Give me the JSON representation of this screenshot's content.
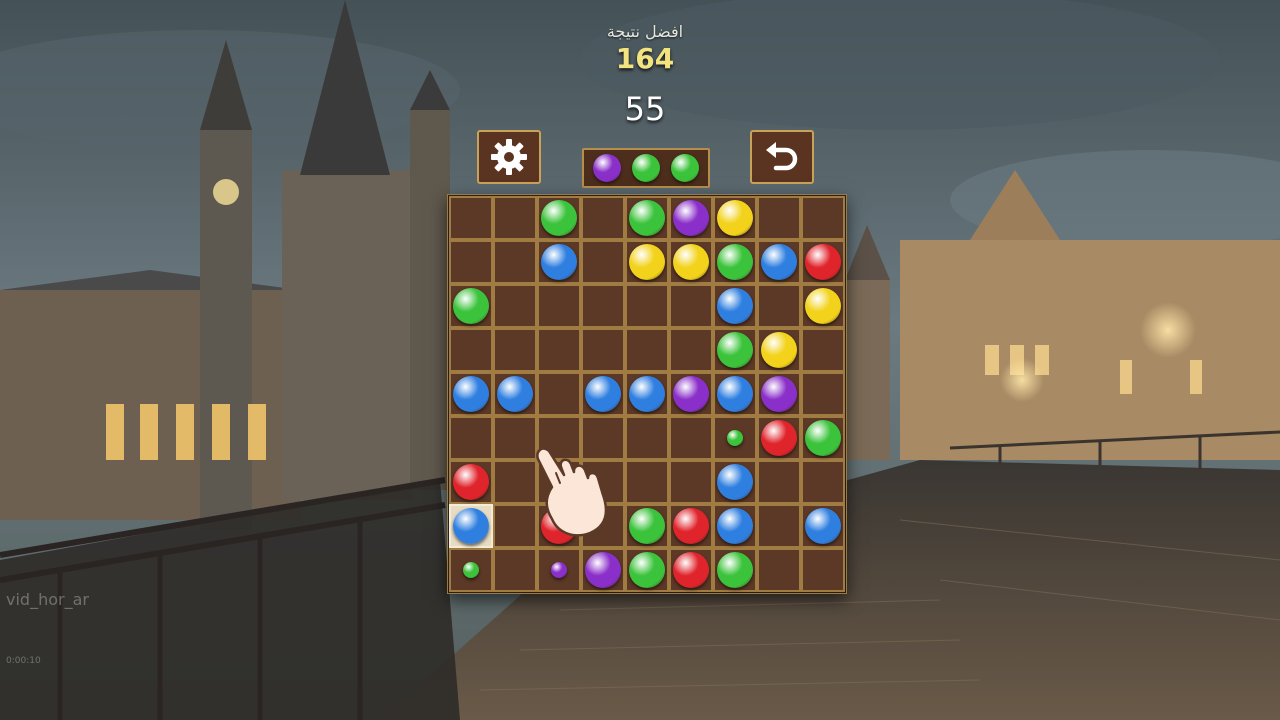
{
  "score": {
    "best_label": "افضل نتيجة",
    "best_value": "164",
    "current_value": "55"
  },
  "toolbar": {
    "settings_icon": "gear-icon",
    "undo_icon": "undo-arrow-icon"
  },
  "next_balls": [
    "purple",
    "green",
    "green"
  ],
  "colors": {
    "green": "#3cc33c",
    "purple": "#8a2fc9",
    "yellow": "#f2d21a",
    "blue": "#2f7fe0",
    "red": "#e0242c",
    "cell": "#5c3826",
    "cell_border": "#a07b42",
    "panel": "#5a3420",
    "score_gold": "#f3e37e"
  },
  "board": {
    "rows": [
      [
        "",
        "",
        "green",
        "",
        "green",
        "purple",
        "yellow",
        "",
        ""
      ],
      [
        "",
        "",
        "blue",
        "",
        "yellow",
        "yellow",
        "green",
        "blue",
        "red"
      ],
      [
        "green",
        "",
        "",
        "",
        "",
        "",
        "blue",
        "",
        "yellow"
      ],
      [
        "",
        "",
        "",
        "",
        "",
        "",
        "green",
        "yellow",
        ""
      ],
      [
        "blue",
        "blue",
        "",
        "blue",
        "blue",
        "purple",
        "blue",
        "purple",
        ""
      ],
      [
        "",
        "",
        "",
        "",
        "",
        "",
        "green:small",
        "red",
        "green"
      ],
      [
        "red",
        "",
        "",
        "",
        "",
        "",
        "blue",
        "",
        ""
      ],
      [
        "blue:selected",
        "",
        "red",
        "",
        "green",
        "red",
        "blue",
        "",
        "blue"
      ],
      [
        "green:small",
        "",
        "purple:small",
        "purple",
        "green",
        "red",
        "green",
        "",
        ""
      ]
    ]
  },
  "tutorial": {
    "hand_icon": "pointing-hand-icon"
  },
  "video_overlay": {
    "title": "vid_hor_ar",
    "time": "0:00:10"
  }
}
